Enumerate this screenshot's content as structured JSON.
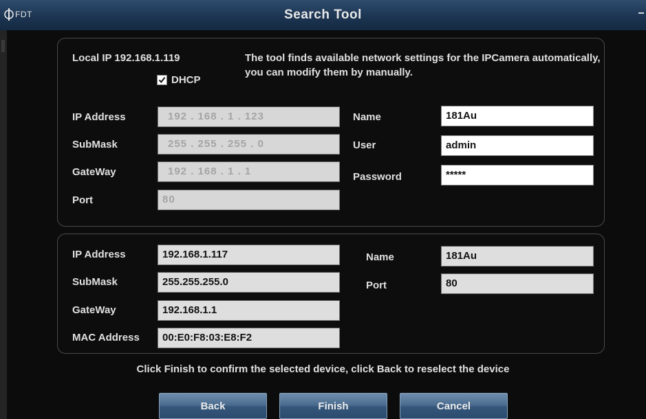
{
  "window": {
    "logo_text": "FDT",
    "title": "Search Tool"
  },
  "discovery": {
    "local_ip_label": "Local IP 192.168.1.119",
    "description": "The tool finds available network settings for the IPCamera automatically, you can modify them by manually.",
    "dhcp_label": "DHCP",
    "dhcp_checked": true,
    "ip_label": "IP Address",
    "ip_value": "192  .  168  .   1   .  123",
    "submask_label": "SubMask",
    "submask_value": "255  .  255  .  255  .   0",
    "gateway_label": "GateWay",
    "gateway_value": "192  .  168  .   1   .   1",
    "port_label": "Port",
    "port_value": "80",
    "name_label": "Name",
    "name_value": "181Au",
    "user_label": "User",
    "user_value": "admin",
    "password_label": "Password",
    "password_value": "*****"
  },
  "device": {
    "ip_label": "IP Address",
    "ip_value": "192.168.1.117",
    "submask_label": "SubMask",
    "submask_value": "255.255.255.0",
    "gateway_label": "GateWay",
    "gateway_value": "192.168.1.1",
    "mac_label": "MAC Address",
    "mac_value": "00:E0:F8:03:E8:F2",
    "name_label": "Name",
    "name_value": "181Au",
    "port_label": "Port",
    "port_value": "80"
  },
  "footer_text": "Click Finish to confirm the selected device, click Back to reselect the device",
  "buttons": {
    "back": "Back",
    "finish": "Finish",
    "cancel": "Cancel"
  },
  "colors": {
    "titlebar": "#1c3552",
    "button": "#4b6d90",
    "background": "#0c0c0c"
  }
}
